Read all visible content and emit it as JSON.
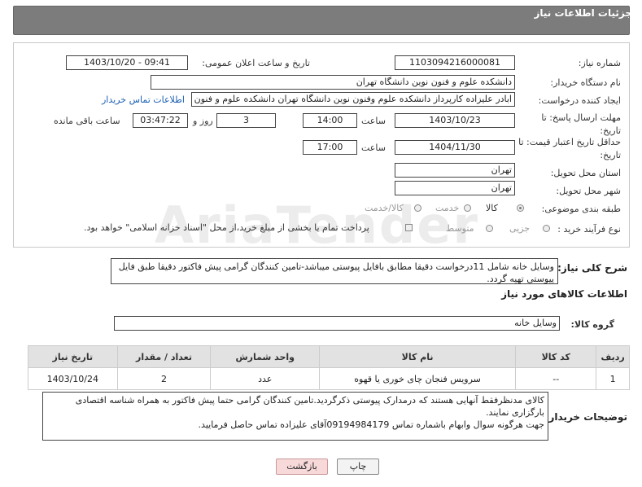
{
  "header": {
    "title": "جزئیات اطلاعات نیاز"
  },
  "form": {
    "need_number_label": "شماره نیاز:",
    "need_number": "1103094216000081",
    "announce_label": "تاریخ و ساعت اعلان عمومی:",
    "announce_value": "1403/10/20 - 09:41",
    "buyer_org_label": "نام دستگاه خریدار:",
    "buyer_org": "دانشکده علوم و فنون نوین دانشگاه تهران",
    "creator_label": "ایجاد کننده درخواست:",
    "creator": "ابادر علیزاده کارپرداز دانشکده علوم وفنون نوین دانشگاه تهران دانشکده علوم و فنون نوین دانشگاه تهران",
    "contact_link": "اطلاعات تماس خریدار",
    "deadline_label": "مهلت ارسال پاسخ: تا تاریخ:",
    "deadline_date": "1403/10/23",
    "time_label": "ساعت",
    "deadline_time": "14:00",
    "days_value": "3",
    "days_label": "روز و",
    "remaining_time": "03:47:22",
    "remaining_label": "ساعت باقی مانده",
    "validity_label": "حداقل تاریخ اعتبار قیمت: تا تاریخ:",
    "validity_date": "1404/11/30",
    "validity_time_label": "ساعت",
    "validity_time": "17:00",
    "province_label": "استان محل تحویل:",
    "province": "تهران",
    "city_label": "شهر محل تحویل:",
    "city": "تهران",
    "category_label": "طبقه بندی موضوعی:",
    "category_options": [
      "کالا",
      "خدمت",
      "کالا/خدمت"
    ],
    "process_label": "نوع فرآیند خرید :",
    "process_options": [
      "جزیی",
      "متوسط"
    ],
    "payment_note": "پرداخت تمام یا بخشی از مبلغ خرید،از محل \"اسناد خزانه اسلامی\" خواهد بود."
  },
  "summary": {
    "label": "شرح کلی نیاز:",
    "text": "وسایل خانه شامل 11درخواست دقیقا مطابق بافایل پیوستی میباشد-تامین کنندگان گرامی پیش فاکتور دقیقا طبق فایل پیوستی تهیه گردد."
  },
  "goods_section": {
    "title": "اطلاعات کالاهای مورد نیاز",
    "group_label": "گروه کالا:",
    "group_value": "وسایل خانه"
  },
  "table": {
    "headers": [
      "ردیف",
      "کد کالا",
      "نام کالا",
      "واحد شمارش",
      "تعداد / مقدار",
      "تاریخ نیاز"
    ],
    "rows": [
      [
        "1",
        "--",
        "سرویس فنجان چای خوری یا قهوه",
        "عدد",
        "2",
        "1403/10/24"
      ]
    ]
  },
  "buyer_notes": {
    "label": "توضیحات خریدار:",
    "line1": "کالای مدنظرفقط آنهایی هستند که درمدارک پیوستی ذکرگردید.تامین کنندگان گرامی حتما پیش فاکتور به همراه شناسه اقتصادی بارگزاری نمایند.",
    "line2": "جهت هرگونه سوال وابهام باشماره تماس 09194984179آقای علیزاده تماس حاصل فرمایید."
  },
  "buttons": {
    "print": "چاپ",
    "back": "بازگشت"
  },
  "colors": {
    "header_bg": "#7c7c7c",
    "link": "#1a5fb4",
    "table_header": "#e2e2e2",
    "back_button": "#f7d9d9"
  }
}
